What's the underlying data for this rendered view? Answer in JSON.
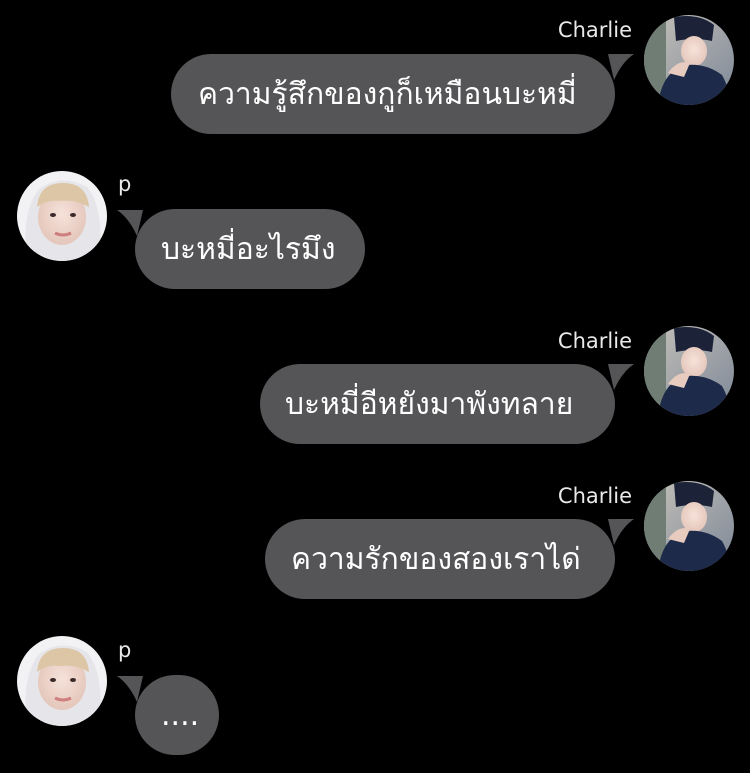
{
  "colors": {
    "background": "#000000",
    "bubble": "#555557",
    "bubble_text": "#ffffff",
    "sender_text": "#e9e9e9"
  },
  "messages": [
    {
      "sender": "Charlie",
      "side": "right",
      "text": "ความรู้สึกของกูก็เหมือนบะหมี่",
      "avatar": "charlie-avatar"
    },
    {
      "sender": "p",
      "side": "left",
      "text": "บะหมี่อะไรมึง",
      "avatar": "p-avatar"
    },
    {
      "sender": "Charlie",
      "side": "right",
      "text": "บะหมี่อีหยังมาพังทลาย",
      "avatar": "charlie-avatar"
    },
    {
      "sender": "Charlie",
      "side": "right",
      "text": "ความรักของสองเราได่",
      "avatar": "charlie-avatar"
    },
    {
      "sender": "p",
      "side": "left",
      "text": "....",
      "avatar": "p-avatar"
    }
  ]
}
